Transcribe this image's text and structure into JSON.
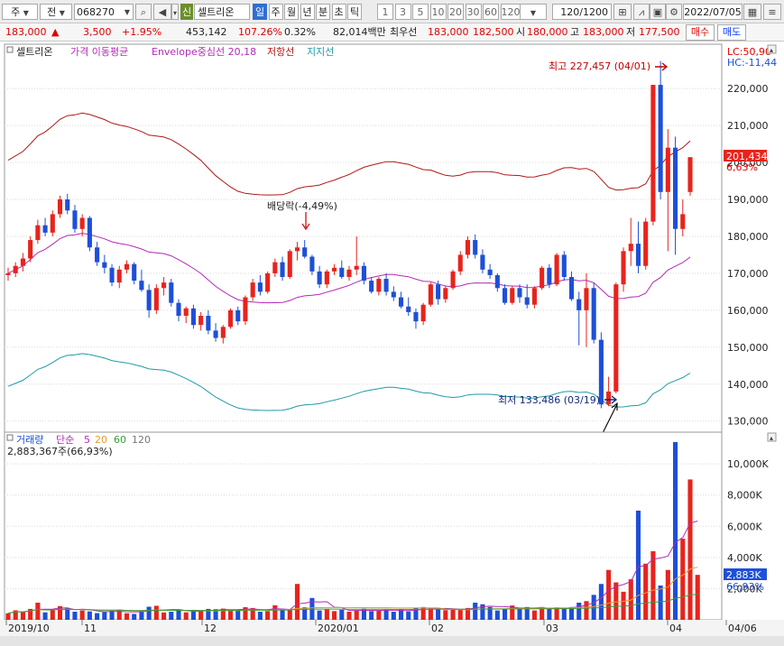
{
  "toolbar": {
    "mode": "주",
    "market": "전",
    "code": "068270",
    "badge": "신",
    "stock_name": "셀트리온",
    "periods": [
      "일",
      "주",
      "월",
      "년",
      "분",
      "초",
      "틱"
    ],
    "active_period": "일",
    "intervals": [
      "1",
      "3",
      "5",
      "10",
      "20",
      "30",
      "60",
      "120"
    ],
    "count": "120",
    "count_total": "/1200",
    "date": "2022/07/05"
  },
  "quote": {
    "price": "183,000",
    "change": "3,500",
    "pct": "+1.95%",
    "volume": "453,142",
    "vol_ratio": "107.26%",
    "turnover": "0.32%",
    "amount": "82,014백만",
    "label_best": "최우선",
    "ask": "183,000",
    "bid": "182,500",
    "label_open": "시",
    "open": "180,000",
    "label_high": "고",
    "high": "183,000",
    "label_low": "저",
    "low": "177,500",
    "buy_label": "매수",
    "sell_label": "매도"
  },
  "price_legend": {
    "name": "셀트리온",
    "ma": "가격 이동평균",
    "envelope": "Envelope중심선 20,18",
    "resistance": "저항선",
    "support": "지지선"
  },
  "volume_legend": {
    "title": "거래량",
    "ma": "단순",
    "p1": "5",
    "p2": "20",
    "p3": "60",
    "p4": "120",
    "value": "2,883,367주(66,93%)"
  },
  "annotations": {
    "high": "최고 227,457 (04/01)",
    "low": "최저 133,486 (03/19)",
    "dividend": "배당락(-4,49%)",
    "lc": "LC:50,90",
    "hc": "HC:-11,44",
    "last_price": "201,434",
    "last_pct": "6,63%",
    "last_volume": "2,883K",
    "volume_pct": "66,93%"
  },
  "colors": {
    "up": "#e8231c",
    "down": "#1d4fd8",
    "resistance": "#b01818",
    "support": "#1f9aa8",
    "ma": "#b12bb5",
    "ma_orange": "#e69a2c",
    "ma_green": "#3a9a3a"
  },
  "chart_data": [
    {
      "type": "candlestick",
      "title": "셀트리온",
      "x_ticks": [
        "2019/10",
        "11",
        "12",
        "2020/01",
        "02",
        "03",
        "04",
        "04/06"
      ],
      "y_ticks": [
        "220,000",
        "210,000",
        "200,000",
        "190,000",
        "180,000",
        "170,000",
        "160,000",
        "150,000",
        "140,000",
        "130,000"
      ],
      "ylim": [
        127000,
        232000
      ],
      "last_close": 201434,
      "highest": 227457,
      "lowest": 133486,
      "candles": [
        [
          169500,
          171500,
          168000,
          170000
        ],
        [
          170000,
          173000,
          169000,
          172000
        ],
        [
          172000,
          175500,
          170500,
          174000
        ],
        [
          174000,
          180000,
          173000,
          179000
        ],
        [
          179000,
          184500,
          178000,
          183000
        ],
        [
          183000,
          185000,
          180000,
          181000
        ],
        [
          181000,
          187000,
          180000,
          186000
        ],
        [
          186000,
          191000,
          185000,
          190000
        ],
        [
          190000,
          191500,
          186000,
          187000
        ],
        [
          187000,
          188500,
          181000,
          182000
        ],
        [
          182000,
          186000,
          180000,
          185000
        ],
        [
          185000,
          185500,
          176000,
          177000
        ],
        [
          177000,
          178500,
          172000,
          173000
        ],
        [
          173000,
          175000,
          170000,
          171500
        ],
        [
          171500,
          172500,
          166500,
          167500
        ],
        [
          167500,
          172000,
          166000,
          171000
        ],
        [
          171000,
          173500,
          170000,
          172500
        ],
        [
          172500,
          173000,
          167000,
          168000
        ],
        [
          168000,
          171000,
          165000,
          165500
        ],
        [
          165500,
          167000,
          158000,
          160000
        ],
        [
          160000,
          167000,
          159000,
          166000
        ],
        [
          166000,
          169000,
          164000,
          167500
        ],
        [
          167500,
          168500,
          161000,
          162000
        ],
        [
          162000,
          163000,
          157000,
          158500
        ],
        [
          158500,
          161000,
          156500,
          160500
        ],
        [
          160500,
          161500,
          155000,
          156000
        ],
        [
          156000,
          159500,
          154500,
          158500
        ],
        [
          158500,
          160000,
          153500,
          154500
        ],
        [
          154500,
          156500,
          151500,
          152500
        ],
        [
          152500,
          156000,
          151000,
          155500
        ],
        [
          155500,
          160500,
          155000,
          160000
        ],
        [
          160000,
          161000,
          156000,
          157000
        ],
        [
          157000,
          164000,
          156000,
          163500
        ],
        [
          163500,
          168500,
          162500,
          167500
        ],
        [
          167500,
          169500,
          164000,
          165000
        ],
        [
          165000,
          170500,
          164500,
          170000
        ],
        [
          170000,
          174000,
          169000,
          173000
        ],
        [
          173000,
          174500,
          168000,
          169000
        ],
        [
          169000,
          176500,
          168500,
          176000
        ],
        [
          176000,
          178500,
          173500,
          177000
        ],
        [
          177000,
          179000,
          174000,
          174500
        ],
        [
          174500,
          175000,
          169500,
          170500
        ],
        [
          170500,
          172000,
          166000,
          167000
        ],
        [
          167000,
          171000,
          166000,
          170500
        ],
        [
          170500,
          172500,
          169500,
          171500
        ],
        [
          171500,
          173500,
          168500,
          169000
        ],
        [
          169000,
          172000,
          168000,
          171000
        ],
        [
          171000,
          180000,
          169500,
          172000
        ],
        [
          172000,
          173000,
          167000,
          168000
        ],
        [
          168000,
          169000,
          164500,
          165000
        ],
        [
          165000,
          169000,
          164000,
          168500
        ],
        [
          168500,
          170000,
          164000,
          165000
        ],
        [
          165000,
          166500,
          162500,
          163500
        ],
        [
          163500,
          165000,
          160500,
          161000
        ],
        [
          161000,
          163500,
          158500,
          159500
        ],
        [
          159500,
          160500,
          155000,
          157000
        ],
        [
          157000,
          162000,
          156000,
          161500
        ],
        [
          161500,
          167500,
          161000,
          167000
        ],
        [
          167000,
          168000,
          161500,
          163000
        ],
        [
          163000,
          166500,
          162000,
          166000
        ],
        [
          166000,
          171000,
          165500,
          170500
        ],
        [
          170500,
          176000,
          169500,
          175000
        ],
        [
          175000,
          180000,
          174000,
          179000
        ],
        [
          179000,
          180500,
          174000,
          175000
        ],
        [
          175000,
          176500,
          170000,
          171000
        ],
        [
          171000,
          172500,
          168500,
          169500
        ],
        [
          169500,
          170000,
          165000,
          166000
        ],
        [
          166000,
          167000,
          161500,
          162000
        ],
        [
          162000,
          166500,
          161500,
          166000
        ],
        [
          166000,
          167000,
          162000,
          163500
        ],
        [
          163500,
          167000,
          160500,
          161500
        ],
        [
          161500,
          166500,
          160500,
          166000
        ],
        [
          166000,
          172000,
          165500,
          171500
        ],
        [
          171500,
          172500,
          166000,
          167000
        ],
        [
          167000,
          175500,
          166500,
          175000
        ],
        [
          175000,
          176000,
          168000,
          169000
        ],
        [
          169000,
          170500,
          162500,
          163000
        ],
        [
          163000,
          165000,
          150500,
          160000
        ],
        [
          160000,
          170000,
          150000,
          166000
        ],
        [
          166000,
          167500,
          151000,
          152000
        ],
        [
          152000,
          154000,
          133486,
          134500
        ],
        [
          134500,
          142000,
          134000,
          138000
        ],
        [
          138000,
          167500,
          137500,
          167000
        ],
        [
          167000,
          177000,
          165000,
          176000
        ],
        [
          176000,
          185000,
          172000,
          178000
        ],
        [
          178000,
          184000,
          170000,
          172000
        ],
        [
          172000,
          185000,
          171000,
          184000
        ],
        [
          184000,
          200000,
          183000,
          221000
        ],
        [
          221000,
          227457,
          190000,
          192000
        ],
        [
          192000,
          209000,
          176000,
          204000
        ],
        [
          204000,
          207000,
          175000,
          182000
        ],
        [
          182000,
          190000,
          180000,
          186000
        ],
        [
          192000,
          200000,
          191000,
          201434
        ]
      ]
    },
    {
      "type": "bar",
      "title": "거래량",
      "y_ticks": [
        "10,000K",
        "8,000K",
        "6,000K",
        "4,000K",
        "2,000K"
      ],
      "ylim": [
        0,
        11800
      ],
      "values": [
        420,
        610,
        520,
        700,
        1100,
        480,
        640,
        880,
        760,
        520,
        600,
        540,
        430,
        500,
        580,
        660,
        420,
        380,
        560,
        840,
        900,
        470,
        520,
        600,
        480,
        640,
        550,
        700,
        680,
        720,
        580,
        630,
        810,
        760,
        520,
        560,
        930,
        700,
        620,
        2300,
        800,
        1400,
        600,
        700,
        560,
        640,
        520,
        600,
        720,
        560,
        600,
        650,
        520,
        680,
        540,
        760,
        820,
        740,
        700,
        620,
        640,
        680,
        760,
        1100,
        1000,
        820,
        600,
        700,
        920,
        760,
        820,
        600,
        820,
        700,
        800,
        760,
        820,
        1100,
        1200,
        1600,
        2300,
        3200,
        2400,
        1800,
        2600,
        7000,
        3600,
        4400,
        2200,
        3200,
        11400,
        5200,
        9000,
        2883
      ]
    }
  ]
}
